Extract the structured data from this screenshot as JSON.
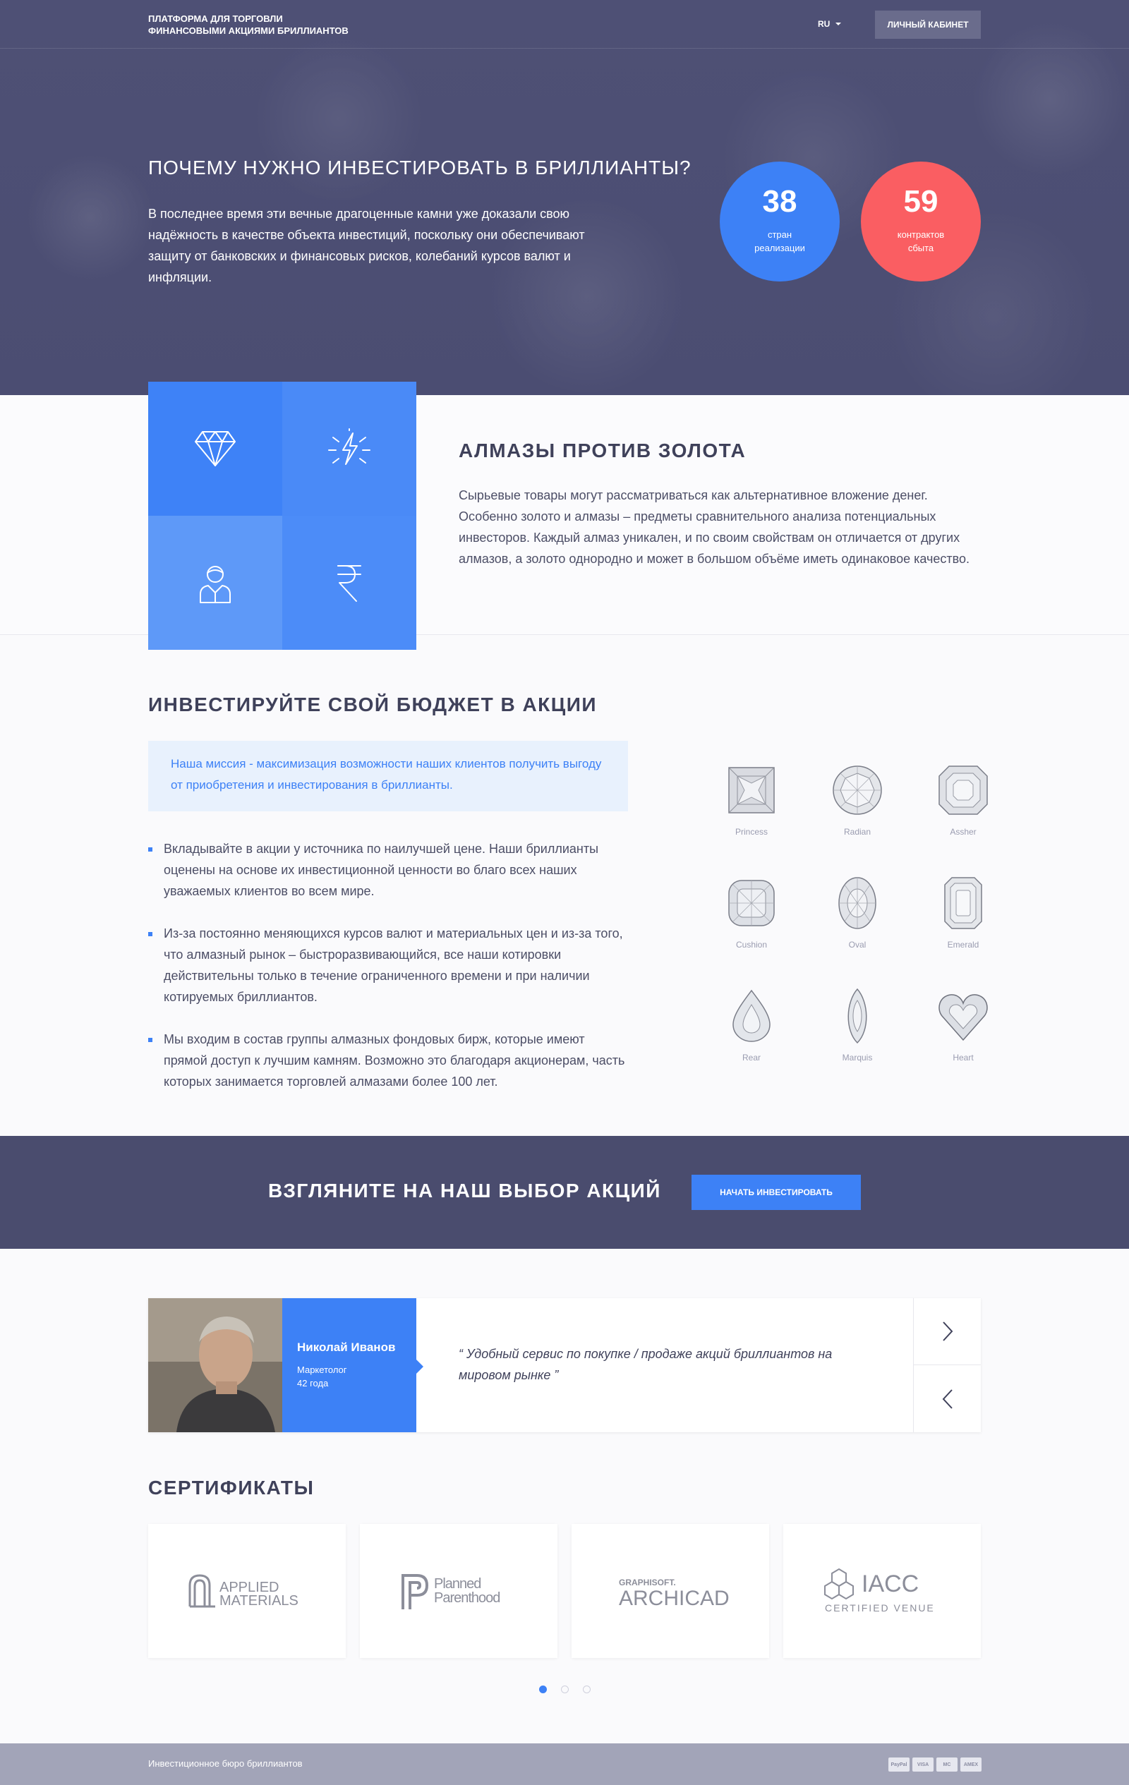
{
  "header": {
    "brand_line1": "ПЛАТФОРМА ДЛЯ ТОРГОВЛИ",
    "brand_line2": "ФИНАНСОВЫМИ АКЦИЯМИ БРИЛЛИАНТОВ",
    "lang": "RU",
    "cabinet": "ЛИЧНЫЙ КАБИНЕТ"
  },
  "hero": {
    "title": "ПОЧЕМУ НУЖНО ИНВЕСТИРОВАТЬ В БРИЛЛИАНТЫ?",
    "text": "В последнее время эти вечные драгоценные камни уже доказали свою надёжность в качестве объекта инвестиций, поскольку они обеспечивают защиту от банковских и финансовых рисков, колебаний курсов валют и инфляции.",
    "stats": [
      {
        "value": "38",
        "label": "стран реализации",
        "color": "#3d81f6"
      },
      {
        "value": "59",
        "label": "контрактов сбыта",
        "color": "#fa5e62"
      }
    ]
  },
  "diamonds_vs_gold": {
    "title": "АЛМАЗЫ ПРОТИВ ЗОЛОТА",
    "text": "Сырьевые товары могут рассматриваться как альтернативное вложение денег. Особенно золото и алмазы – предметы сравнительного анализа потенциальных инвесторов. Каждый алмаз уникален, и по своим свойствам он отличается от других алмазов, а золото однородно и может в большом объёме иметь одинаковое качество.",
    "tiles": [
      "diamond-icon",
      "lightning-icon",
      "user-icon",
      "rupee-icon"
    ]
  },
  "invest": {
    "title": "ИНВЕСТИРУЙТЕ СВОЙ БЮДЖЕТ В АКЦИИ",
    "mission": "Наша миссия - максимизация возможности наших клиентов получить выгоду от приобретения и инвестирования в бриллианты.",
    "bullets": [
      "Вкладывайте в акции  у источника по наилучшей цене. Наши бриллианты оценены на основе их инвестиционной ценности во благо всех наших уважаемых клиентов во всем мире.",
      "Из-за постоянно меняющихся курсов валют и материальных цен и из-за того, что алмазный рынок – быстроразвивающийся, все наши котировки действительны только в течение ограниченного времени и при наличии котируемых бриллиантов.",
      "Мы входим в состав группы алмазных фондовых бирж, которые имеют прямой доступ к лучшим камням. Возможно это благодаря акционерам, часть которых занимается торговлей алмазами более 100 лет."
    ],
    "gems": [
      "Princess",
      "Radian",
      "Assher",
      "Cushion",
      "Oval",
      "Emerald",
      "Rear",
      "Marquis",
      "Heart"
    ]
  },
  "cta": {
    "title": "ВЗГЛЯНИТЕ НА НАШ ВЫБОР АКЦИЙ",
    "button": "НАЧАТЬ ИНВЕСТИРОВАТЬ"
  },
  "testimonial": {
    "name": "Николай Иванов",
    "role": "Маркетолог",
    "age": "42 года",
    "quote": "“ Удобный сервис по покупке / продаже акций бриллиантов на мировом рынке ”"
  },
  "certificates": {
    "title": "СЕРТИФИКАТЫ",
    "logos": [
      {
        "line1": "APPLIED",
        "line2": "MATERIALS"
      },
      {
        "line1": "Planned",
        "line2": "Parenthood"
      },
      {
        "line1": "GRAPHISOFT.",
        "line2": "ARCHICAD"
      },
      {
        "line1": "IACC",
        "line2": "CERTIFIED VENUE"
      }
    ],
    "pages": 3,
    "active_page": 1
  },
  "footer": {
    "text": "Инвестиционное бюро бриллиантов",
    "payments": [
      "PayPal",
      "VISA",
      "MC",
      "AMEX"
    ]
  }
}
